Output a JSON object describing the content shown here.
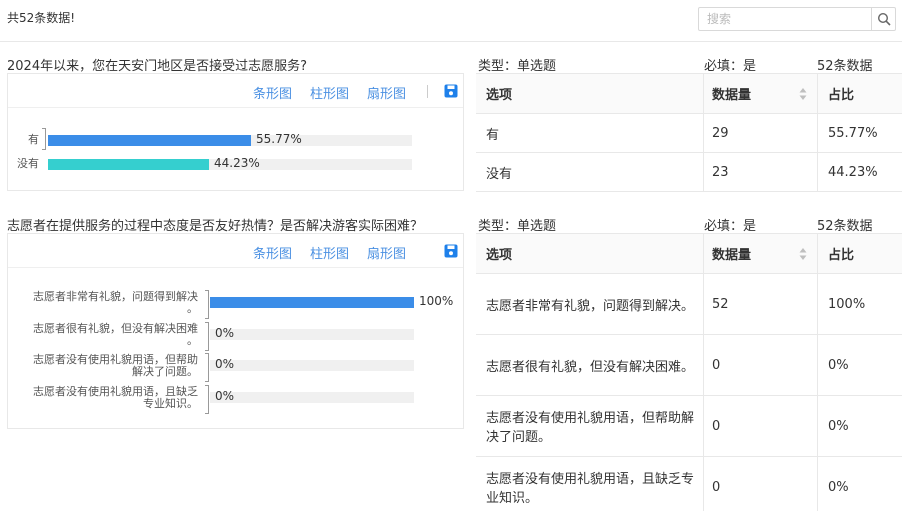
{
  "header": {
    "total_text": "共52条数据!",
    "search_placeholder": "搜索"
  },
  "tabs": {
    "bar_h": "条形图",
    "bar_v": "柱形图",
    "pie": "扇形图"
  },
  "table_headers": {
    "option": "选项",
    "count": "数据量",
    "ratio": "占比"
  },
  "colors": {
    "bar_series_1": "#3b8de8",
    "bar_series_2": "#35cfcf",
    "link": "#4a90e2",
    "save_icon": "#1e80ea"
  },
  "questions": [
    {
      "title": "2024年以来，您在天安门地区是否接受过志愿服务?",
      "type": "类型：单选题",
      "required": "必填：是",
      "count_text": "52条数据",
      "chart_data": {
        "type": "bar",
        "orientation": "horizontal",
        "categories": [
          "有",
          "没有"
        ],
        "values": [
          55.77,
          44.23
        ],
        "labels": [
          "55.77%",
          "44.23%"
        ],
        "xlim": [
          0,
          100
        ]
      },
      "rows": [
        {
          "option": "有",
          "count": "29",
          "ratio": "55.77%"
        },
        {
          "option": "没有",
          "count": "23",
          "ratio": "44.23%"
        }
      ]
    },
    {
      "title": "志愿者在提供服务的过程中态度是否友好热情？是否解决游客实际困难？",
      "type": "类型：单选题",
      "required": "必填：是",
      "count_text": "52条数据",
      "chart_data": {
        "type": "bar",
        "orientation": "horizontal",
        "categories": [
          [
            "志愿者非常有礼貌，问题得到解决",
            "。"
          ],
          [
            "志愿者很有礼貌，但没有解决困难",
            "。"
          ],
          [
            "志愿者没有使用礼貌用语，但帮助",
            "解决了问题。"
          ],
          [
            "志愿者没有使用礼貌用语，且缺乏",
            "专业知识。"
          ]
        ],
        "values": [
          100,
          0,
          0,
          0
        ],
        "labels": [
          "100%",
          "0%",
          "0%",
          "0%"
        ],
        "xlim": [
          0,
          100
        ]
      },
      "rows": [
        {
          "option": "志愿者非常有礼貌，问题得到解决。",
          "count": "52",
          "ratio": "100%"
        },
        {
          "option": "志愿者很有礼貌，但没有解决困难。",
          "count": "0",
          "ratio": "0%"
        },
        {
          "option": "志愿者没有使用礼貌用语，但帮助解决了问题。",
          "count": "0",
          "ratio": "0%"
        },
        {
          "option": "志愿者没有使用礼貌用语，且缺乏专业知识。",
          "count": "0",
          "ratio": "0%"
        }
      ]
    }
  ]
}
